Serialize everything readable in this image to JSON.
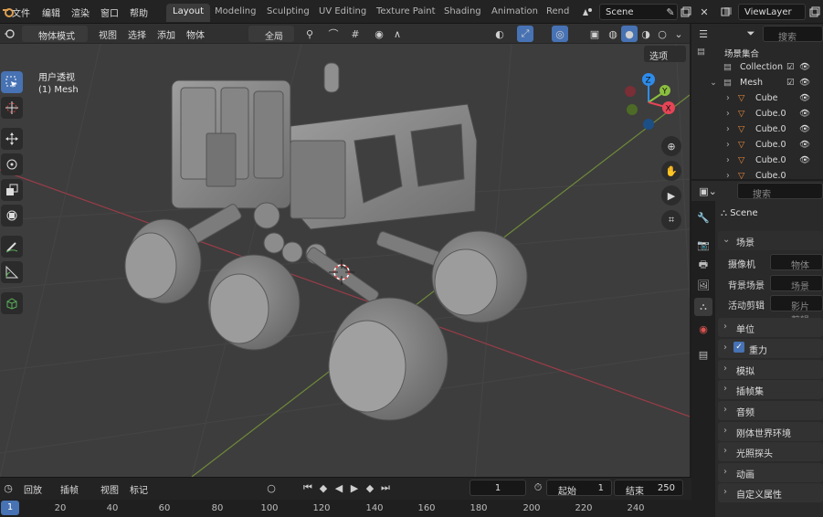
{
  "menu": {
    "file": "文件",
    "edit": "编辑",
    "render": "渲染",
    "window": "窗口",
    "help": "帮助"
  },
  "workspaces": [
    "Layout",
    "Modeling",
    "Sculpting",
    "UV Editing",
    "Texture Paint",
    "Shading",
    "Animation",
    "Rend"
  ],
  "scene": {
    "name": "Scene",
    "viewlayer": "ViewLayer"
  },
  "viewport_header": {
    "mode": "物体模式",
    "view": "视图",
    "select": "选择",
    "add": "添加",
    "object": "物体",
    "transform": "全局",
    "options": "选项"
  },
  "viewport": {
    "view_label": "用户透视",
    "object_label": "(1) Mesh"
  },
  "gizmo": {
    "z": "Z",
    "y": "Y",
    "x": "X"
  },
  "outliner": {
    "search_placeholder": "搜索",
    "root": "场景集合",
    "items": [
      "Collection",
      "Mesh",
      "Cube",
      "Cube.0",
      "Cube.0",
      "Cube.0",
      "Cube.0",
      "Cube.0"
    ]
  },
  "properties": {
    "search_placeholder": "搜索",
    "scene_name": "Scene",
    "panel": "场景",
    "camera_label": "摄像机",
    "camera_value": "物体",
    "bg_label": "背景场景",
    "bg_value": "场景",
    "clip_label": "活动剪辑",
    "clip_value": "影片剪辑",
    "sections": [
      "单位",
      "重力",
      "模拟",
      "插帧集",
      "音频",
      "刚体世界环境",
      "光照探头",
      "动画",
      "自定义属性"
    ],
    "gravity_checked": true
  },
  "timeline": {
    "playback": "回放",
    "keying": "插帧",
    "view": "视图",
    "marker": "标记",
    "current_frame": "1",
    "start_label": "起始",
    "start": "1",
    "end_label": "结束",
    "end": "250",
    "ruler": [
      "1",
      "20",
      "40",
      "60",
      "80",
      "100",
      "120",
      "140",
      "160",
      "180",
      "200",
      "220",
      "240"
    ]
  },
  "colors": {
    "accent": "#4772b3",
    "x_axis": "#e64556",
    "y_axis": "#8bbf3f",
    "z_axis": "#2d8ceb",
    "mesh_icon": "#e6873c"
  }
}
